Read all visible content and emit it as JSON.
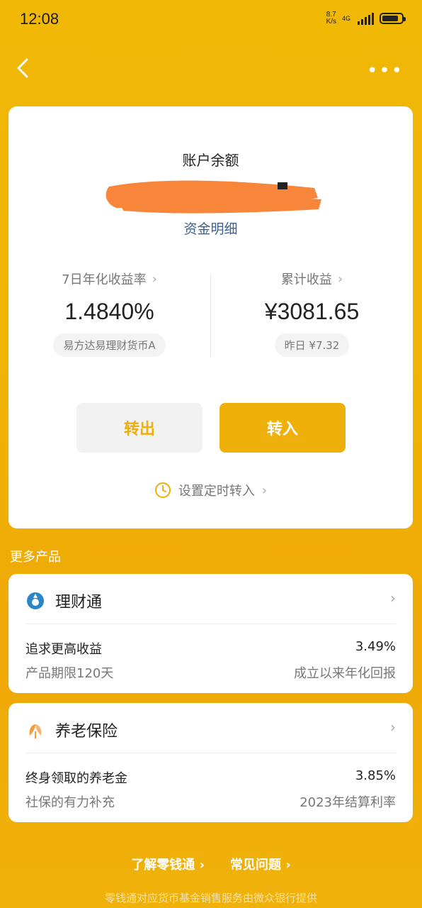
{
  "status_bar": {
    "time": "12:08",
    "net_speed_value": "8.7",
    "net_speed_unit": "K/s",
    "network": "4G"
  },
  "nav": {
    "more": "•••"
  },
  "account": {
    "balance_title": "账户余额",
    "detail_link": "资金明细",
    "left_label": "7日年化收益率",
    "left_value": "1.4840%",
    "left_pill": "易方达易理财货币A",
    "right_label": "累计收益",
    "right_value": "¥3081.65",
    "right_pill": "昨日 ¥7.32",
    "btn_out": "转出",
    "btn_in": "转入",
    "timer_label": "设置定时转入"
  },
  "more_products": {
    "title": "更多产品",
    "items": [
      {
        "name": "理财通",
        "desc": "追求更高收益",
        "rate": "3.49%",
        "sub": "产品期限120天",
        "rate_note": "成立以来年化回报"
      },
      {
        "name": "养老保险",
        "desc": "终身领取的养老金",
        "rate": "3.85%",
        "sub": "社保的有力补充",
        "rate_note": "2023年结算利率"
      }
    ]
  },
  "footer": {
    "link_about": "了解零钱通",
    "link_faq": "常见问题",
    "disclaimer": "零钱通对应货币基金销售服务由微众银行提供"
  },
  "colors": {
    "brand": "#efb00c",
    "link": "#3b6191"
  }
}
